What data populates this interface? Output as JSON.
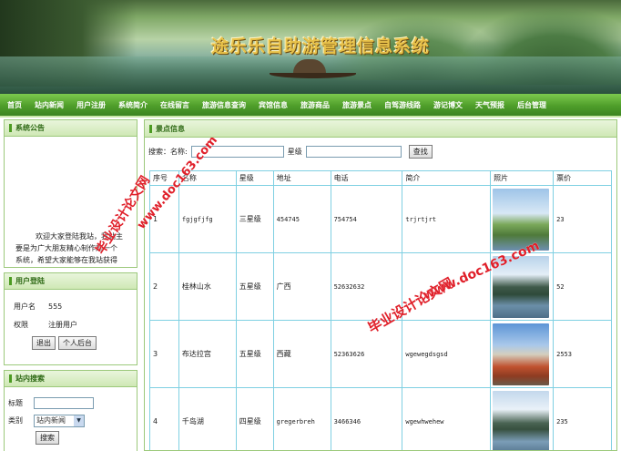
{
  "banner": {
    "title": "途乐乐自助游管理信息系统"
  },
  "nav": [
    {
      "label": "首页"
    },
    {
      "label": "站内新闻"
    },
    {
      "label": "用户注册"
    },
    {
      "label": "系统简介"
    },
    {
      "label": "在线留言"
    },
    {
      "label": "旅游信息查询"
    },
    {
      "label": "宾馆信息"
    },
    {
      "label": "旅游商品"
    },
    {
      "label": "旅游景点"
    },
    {
      "label": "自驾游线路"
    },
    {
      "label": "游记博文"
    },
    {
      "label": "天气预报"
    },
    {
      "label": "后台管理"
    }
  ],
  "sidebar": {
    "notice": {
      "title": "系统公告",
      "lines": [
        "欢迎大家登陆我站，我站主",
        "要是为广大朋友精心制作的一个",
        "系统，希望大家能够在我站获得"
      ]
    },
    "login": {
      "title": "用户登陆",
      "username_label": "用户名",
      "username_value": "555",
      "role_label": "权限",
      "role_value": "注册用户",
      "logout_button": "退出",
      "backend_button": "个人后台"
    },
    "search": {
      "title": "站内搜索",
      "title_label": "标题",
      "type_label": "类别",
      "type_value": "站内新闻",
      "submit_button": "搜索"
    }
  },
  "main": {
    "title": "景点信息",
    "search_label": "搜索：名称:",
    "star_label": "星级",
    "search_button": "查找",
    "columns": [
      "序号",
      "名称",
      "星级",
      "地址",
      "电话",
      "简介",
      "照片",
      "票价"
    ],
    "rows": [
      {
        "no": "1",
        "name": "fgjgfjfg",
        "star": "三星级",
        "address": "454745",
        "phone": "754754",
        "intro": "trjrtjrt",
        "photo": "pic1",
        "price": "23"
      },
      {
        "no": "2",
        "name": "桂林山水",
        "star": "五星级",
        "address": "广西",
        "phone": "52632632",
        "intro": "",
        "photo": "pic2",
        "price": "52"
      },
      {
        "no": "3",
        "name": "布达拉宫",
        "star": "五星级",
        "address": "西藏",
        "phone": "52363626",
        "intro": "wgewegdsgsd",
        "photo": "pic3",
        "price": "2553"
      },
      {
        "no": "4",
        "name": "千岛湖",
        "star": "四星级",
        "address": "gregerbreh",
        "phone": "3466346",
        "intro": "wgewhwehew",
        "photo": "pic4",
        "price": "235"
      }
    ]
  },
  "watermarks": {
    "a": "毕业设计论文网",
    "b": "www.doc163.com"
  }
}
